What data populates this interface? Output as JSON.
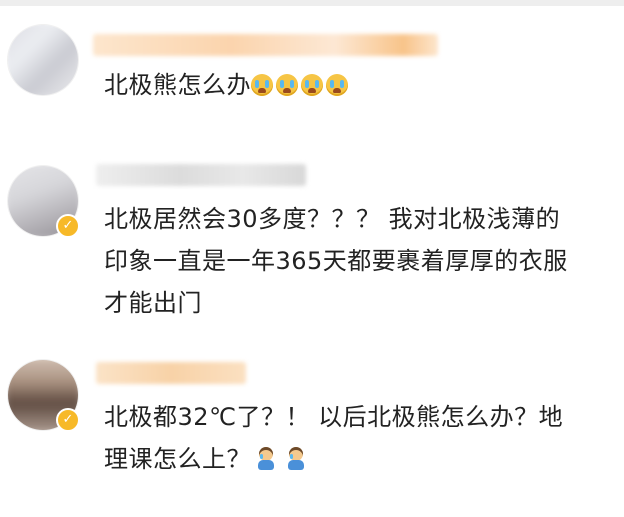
{
  "comments": [
    {
      "text": "北极熊怎么办",
      "emoji": "loudly-crying-face",
      "emoji_count": 4
    },
    {
      "text": "北极居然会30多度？？？ 我对北极浅薄的\n印象一直是一年365天都要裹着厚厚的衣服\n才能出门"
    },
    {
      "text": "北极都32℃了？！ 以后北极熊怎么办？地\n理课怎么上？",
      "emoji": "crying-child",
      "emoji_count": 2
    }
  ],
  "colors": {
    "text": "#222222",
    "verified_badge": "#f7b928",
    "emoji_tear": "#59b8ef"
  }
}
